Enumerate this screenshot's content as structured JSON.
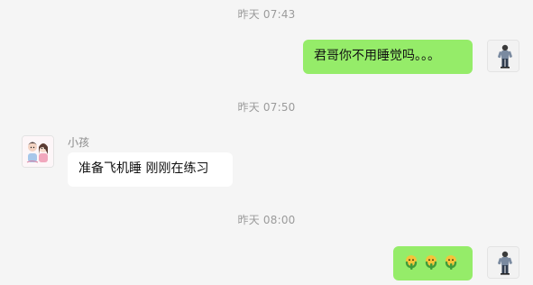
{
  "chat": {
    "messages": [
      {
        "time": "昨天 07:43",
        "sender": "self",
        "text": "君哥你不用睡觉吗。。。"
      },
      {
        "time": "昨天 07:50",
        "sender": "小孩",
        "text": "准备飞机睡  刚刚在练习"
      },
      {
        "time": "昨天 08:00",
        "sender": "self",
        "emoji": [
          "cactus-emoji",
          "cactus-emoji",
          "cactus-emoji"
        ]
      }
    ]
  },
  "colors": {
    "background": "#f5f5f5",
    "outgoing_bubble": "#95ec69",
    "incoming_bubble": "#ffffff",
    "timestamp_text": "#9b9b9b",
    "name_text": "#8a8a8a"
  },
  "icons": {
    "self_avatar": "person-standing-avatar",
    "contact_avatar": "cartoon-couple-avatar",
    "emoji": "cactus-emoji"
  }
}
